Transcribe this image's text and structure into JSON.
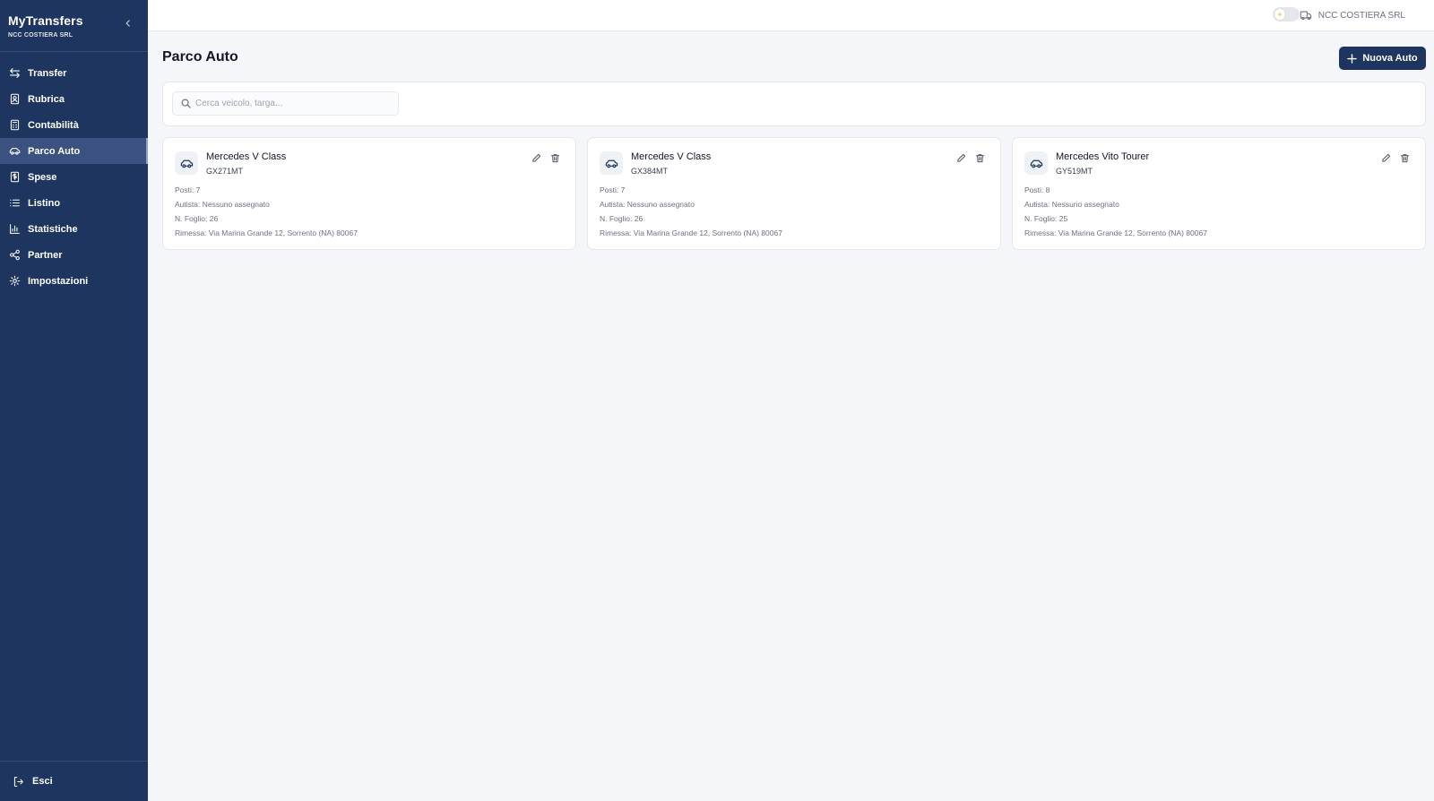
{
  "app": {
    "title": "MyTransfers",
    "subtitle": "NCC COSTIERA SRL"
  },
  "sidebar": {
    "items": [
      {
        "label": "Transfer",
        "icon": "arrows-swap-icon"
      },
      {
        "label": "Rubrica",
        "icon": "address-book-icon"
      },
      {
        "label": "Contabilità",
        "icon": "calculator-icon"
      },
      {
        "label": "Parco Auto",
        "icon": "car-icon",
        "active": true
      },
      {
        "label": "Spese",
        "icon": "receipt-icon"
      },
      {
        "label": "Listino",
        "icon": "list-icon"
      },
      {
        "label": "Statistiche",
        "icon": "bar-chart-icon"
      },
      {
        "label": "Partner",
        "icon": "share-icon"
      },
      {
        "label": "Impostazioni",
        "icon": "gear-icon"
      }
    ],
    "logout_label": "Esci"
  },
  "topbar": {
    "company": "NCC COSTIERA SRL"
  },
  "page": {
    "title": "Parco Auto",
    "new_button_label": "Nuova Auto",
    "search_placeholder": "Cerca veicolo, targa..."
  },
  "vehicles": [
    {
      "name": "Mercedes V Class",
      "plate": "GX271MT",
      "seats": "Posti: 7",
      "driver": "Autista: Nessuno assegnato",
      "sheet": "N. Foglio: 26",
      "garage": "Rimessa: Via Marina Grande 12, Sorrento (NA) 80067"
    },
    {
      "name": "Mercedes V Class",
      "plate": "GX384MT",
      "seats": "Posti: 7",
      "driver": "Autista: Nessuno assegnato",
      "sheet": "N. Foglio: 26",
      "garage": "Rimessa: Via Marina Grande 12, Sorrento (NA) 80067"
    },
    {
      "name": "Mercedes Vito Tourer",
      "plate": "GY519MT",
      "seats": "Posti: 8",
      "driver": "Autista: Nessuno assegnato",
      "sheet": "N. Foglio: 25",
      "garage": "Rimessa: Via Marina Grande 12, Sorrento (NA) 80067"
    }
  ],
  "colors": {
    "sidebar_bg": "#1e3560",
    "accent": "#1e3560",
    "page_bg": "#f4f6fa"
  }
}
